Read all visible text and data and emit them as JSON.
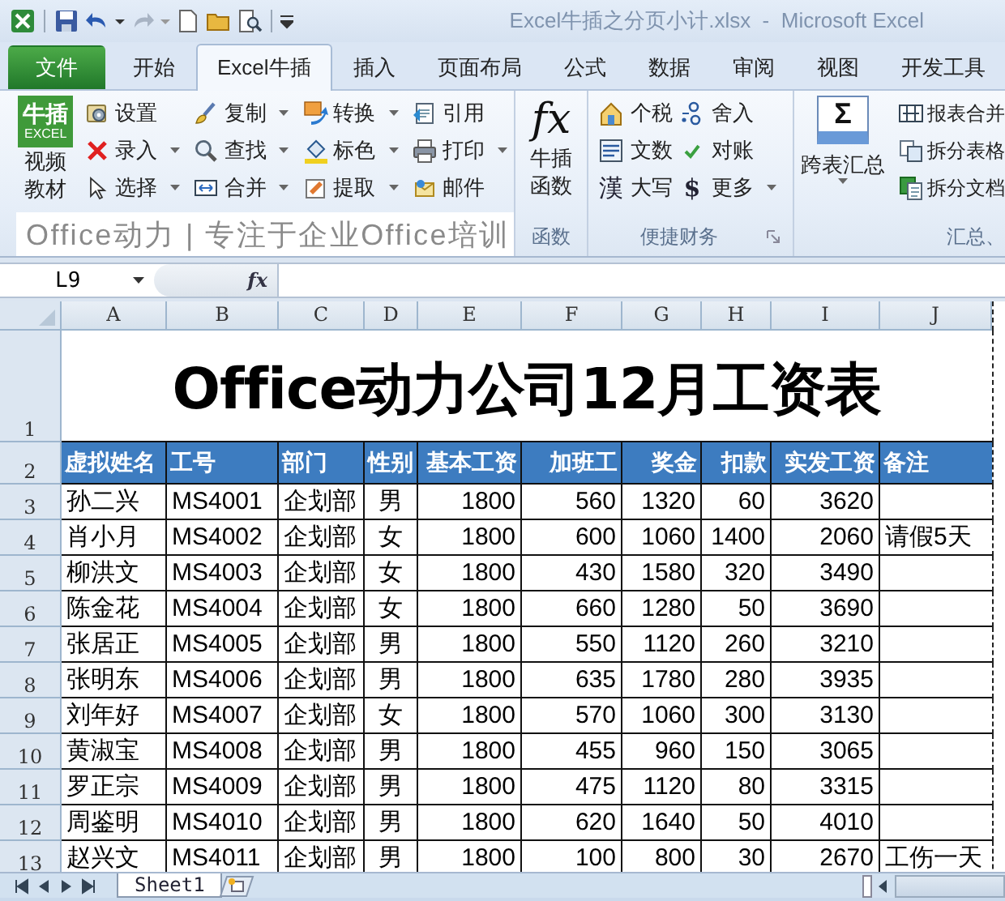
{
  "title_bar": {
    "title": "Excel牛插之分页小计.xlsx  -  Microsoft Excel"
  },
  "tabs": [
    {
      "label": "文件",
      "kind": "file",
      "selected": false
    },
    {
      "label": "开始",
      "kind": "tab",
      "selected": false
    },
    {
      "label": "Excel牛插",
      "kind": "tab",
      "selected": true
    },
    {
      "label": "插入",
      "kind": "tab",
      "selected": false
    },
    {
      "label": "页面布局",
      "kind": "tab",
      "selected": false
    },
    {
      "label": "公式",
      "kind": "tab",
      "selected": false
    },
    {
      "label": "数据",
      "kind": "tab",
      "selected": false
    },
    {
      "label": "审阅",
      "kind": "tab",
      "selected": false
    },
    {
      "label": "视图",
      "kind": "tab",
      "selected": false
    },
    {
      "label": "开发工具",
      "kind": "tab",
      "selected": false
    }
  ],
  "ribbon": {
    "video_group": {
      "logo_title": "牛插",
      "logo_subtitle": "EXCEL",
      "button_label": "视频教材",
      "columns": [
        [
          {
            "label": "设置",
            "dropdown": false
          },
          {
            "label": "录入",
            "dropdown": true
          },
          {
            "label": "选择",
            "dropdown": true
          }
        ],
        [
          {
            "label": "复制",
            "dropdown": true
          },
          {
            "label": "查找",
            "dropdown": true
          },
          {
            "label": "合并",
            "dropdown": true
          }
        ],
        [
          {
            "label": "转换",
            "dropdown": true
          },
          {
            "label": "标色",
            "dropdown": true
          },
          {
            "label": "提取",
            "dropdown": true
          }
        ],
        [
          {
            "label": "引用",
            "dropdown": false
          },
          {
            "label": "打印",
            "dropdown": true
          },
          {
            "label": "邮件",
            "dropdown": false
          }
        ]
      ],
      "banner": "Office动力 | 专注于企业Office培训"
    },
    "function_group": {
      "symbol": "fx",
      "button_label": "牛插函数",
      "label": "函数"
    },
    "finance_group": {
      "columns": [
        [
          {
            "label": "个税",
            "dropdown": false
          },
          {
            "label": "文数",
            "dropdown": false
          },
          {
            "label": "大写",
            "symbol": "漢",
            "dropdown": false
          }
        ],
        [
          {
            "label": "舍入",
            "dropdown": false
          },
          {
            "label": "对账",
            "dropdown": false
          },
          {
            "label": "更多",
            "symbol": "$",
            "dropdown": true
          }
        ]
      ],
      "label": "便捷财务"
    },
    "summary_group": {
      "symbol": "Σ",
      "button_label": "跨表汇总",
      "dropdown": true,
      "buttons": [
        {
          "label": "报表合并"
        },
        {
          "label": "拆分表格"
        },
        {
          "label": "拆分文档"
        }
      ],
      "label": "汇总、"
    }
  },
  "formula_bar": {
    "name_box": "L9",
    "function_label": "fx"
  },
  "sheet": {
    "columns": [
      "A",
      "B",
      "C",
      "D",
      "E",
      "F",
      "G",
      "H",
      "I",
      "J"
    ],
    "row_numbers": [
      "1",
      "2",
      "3",
      "4",
      "5",
      "6",
      "7",
      "8",
      "9",
      "10",
      "11",
      "12",
      "13"
    ],
    "title": "Office动力公司12月工资表",
    "headers": [
      "虚拟姓名",
      "工号",
      "部门",
      "性别",
      "基本工资",
      "加班工",
      "奖金",
      "扣款",
      "实发工资",
      "备注"
    ],
    "rows": [
      [
        "孙二兴",
        "MS4001",
        "企划部",
        "男",
        "1800",
        "560",
        "1320",
        "60",
        "3620"
      ],
      [
        "肖小月",
        "MS4002",
        "企划部",
        "女",
        "1800",
        "600",
        "1060",
        "1400",
        "2060",
        "请假5天"
      ],
      [
        "柳洪文",
        "MS4003",
        "企划部",
        "女",
        "1800",
        "430",
        "1580",
        "320",
        "3490"
      ],
      [
        "陈金花",
        "MS4004",
        "企划部",
        "女",
        "1800",
        "660",
        "1280",
        "50",
        "3690"
      ],
      [
        "张居正",
        "MS4005",
        "企划部",
        "男",
        "1800",
        "550",
        "1120",
        "260",
        "3210"
      ],
      [
        "张明东",
        "MS4006",
        "企划部",
        "男",
        "1800",
        "635",
        "1780",
        "280",
        "3935"
      ],
      [
        "刘年好",
        "MS4007",
        "企划部",
        "女",
        "1800",
        "570",
        "1060",
        "300",
        "3130"
      ],
      [
        "黄淑宝",
        "MS4008",
        "企划部",
        "男",
        "1800",
        "455",
        "960",
        "150",
        "3065"
      ],
      [
        "罗正宗",
        "MS4009",
        "企划部",
        "男",
        "1800",
        "475",
        "1120",
        "80",
        "3315"
      ],
      [
        "周鉴明",
        "MS4010",
        "企划部",
        "男",
        "1800",
        "620",
        "1640",
        "50",
        "4010"
      ],
      [
        "赵兴文",
        "MS4011",
        "企划部",
        "男",
        "1800",
        "100",
        "800",
        "30",
        "2670",
        "工伤一天"
      ]
    ]
  },
  "sheet_tabs": [
    {
      "label": "Sheet1",
      "selected": true
    }
  ]
}
